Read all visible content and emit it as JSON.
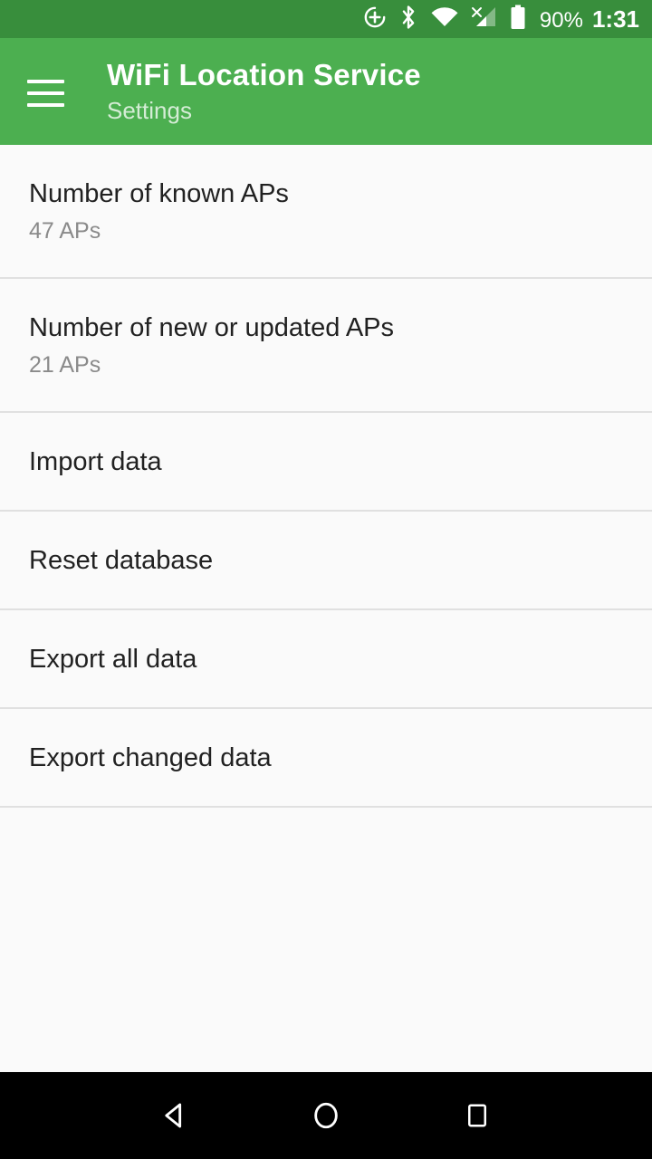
{
  "status_bar": {
    "icons": [
      {
        "name": "data-saver-icon"
      },
      {
        "name": "bluetooth-icon"
      },
      {
        "name": "wifi-full-signal-icon"
      },
      {
        "name": "cellular-no-service-icon"
      },
      {
        "name": "battery-icon"
      }
    ],
    "battery_percent": "90%",
    "time": "1:31",
    "background_color": "#388E3C",
    "text_color": "#FFFFFF"
  },
  "app_bar": {
    "menu_icon": "hamburger-menu-icon",
    "title": "WiFi Location Service",
    "subtitle": "Settings",
    "background_color": "#4CAF50"
  },
  "settings_list": {
    "background_color": "#FAFAFA",
    "divider_color": "#E0E0E0",
    "items": [
      {
        "title": "Number of known APs",
        "subtitle": "47 APs"
      },
      {
        "title": "Number of new or updated APs",
        "subtitle": "21 APs"
      },
      {
        "title": "Import data",
        "subtitle": null
      },
      {
        "title": "Reset database",
        "subtitle": null
      },
      {
        "title": "Export all data",
        "subtitle": null
      },
      {
        "title": "Export changed data",
        "subtitle": null
      }
    ]
  },
  "nav_bar": {
    "background_color": "#000000",
    "buttons": [
      {
        "name": "back-button"
      },
      {
        "name": "home-button"
      },
      {
        "name": "recents-button"
      }
    ]
  }
}
